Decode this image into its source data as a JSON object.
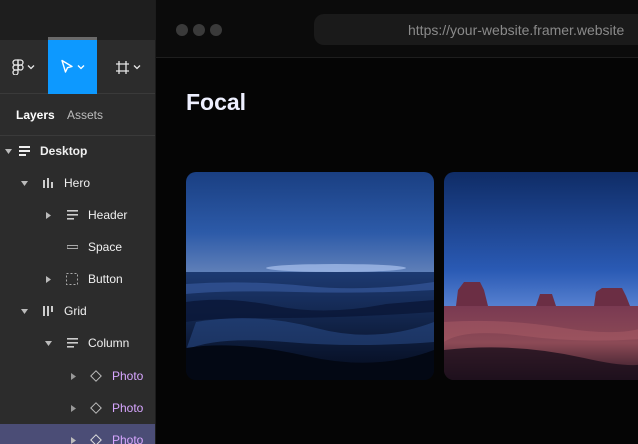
{
  "toolbar": {
    "tools": [
      {
        "icon": "figma-logo-icon",
        "dropdown": "chevron-down-icon"
      },
      {
        "icon": "move-cursor-icon",
        "dropdown": "chevron-down-icon",
        "active": true
      },
      {
        "icon": "frame-grid-icon",
        "dropdown": "chevron-down-icon"
      }
    ]
  },
  "panel_tabs": {
    "layers": "Layers",
    "assets": "Assets"
  },
  "layers": [
    {
      "label": "Desktop",
      "icon": "stack-layout-icon"
    },
    {
      "label": "Hero",
      "icon": "column-layout-icon"
    },
    {
      "label": "Header",
      "icon": "text-lines-icon"
    },
    {
      "label": "Space",
      "icon": "spacer-icon"
    },
    {
      "label": "Button",
      "icon": "dashed-frame-icon"
    },
    {
      "label": "Grid",
      "icon": "grid-layout-icon"
    },
    {
      "label": "Column",
      "icon": "stack-layout-icon"
    },
    {
      "label": "Photo",
      "icon": "component-diamond-icon"
    },
    {
      "label": "Photo",
      "icon": "component-diamond-icon"
    },
    {
      "label": "Photo",
      "icon": "component-diamond-icon"
    }
  ],
  "browser": {
    "url": "https://your-website.framer.website",
    "site_title": "Focal"
  },
  "colors": {
    "accent": "#0d99ff",
    "selection": "#4b4d76",
    "component": "#d7a6ff",
    "panel_bg": "#2c2c2c"
  }
}
